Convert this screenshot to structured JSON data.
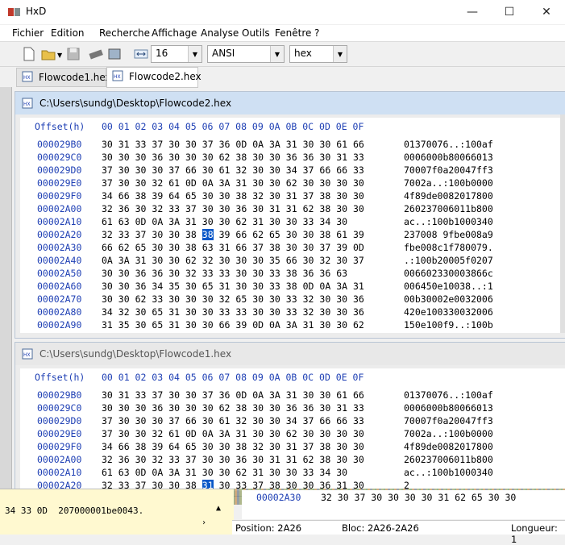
{
  "app": {
    "title": "HxD"
  },
  "window_controls": {
    "minimize": "—",
    "maximize": "☐",
    "close": "✕"
  },
  "menu": [
    "Fichier",
    "Edition",
    "Recherche",
    "Affichage",
    "Analyse",
    "Outils",
    "Fenêtre",
    "?"
  ],
  "toolbar": {
    "bytes_per_row": "16",
    "charset": "ANSI",
    "display_mode": "hex"
  },
  "tabs": [
    {
      "label": "Flowcode1.hex"
    },
    {
      "label": "Flowcode2.hex"
    }
  ],
  "windows": [
    {
      "caption": "C:\\Users\\sundg\\Desktop\\Flowcode2.hex",
      "header_offset": "Offset(h)",
      "header_cols": "00 01 02 03 04 05 06 07 08 09 0A 0B 0C 0D 0E 0F",
      "rows": [
        {
          "off": "000029B0",
          "hex": "30 31 33 37 30 30 37 36 0D 0A 3A 31 30 30 61 66",
          "text": "01370076..:100af"
        },
        {
          "off": "000029C0",
          "hex": "30 30 30 36 30 30 30 62 38 30 30 36 36 30 31 33",
          "text": "0006000b80066013"
        },
        {
          "off": "000029D0",
          "hex": "37 30 30 30 37 66 30 61 32 30 30 34 37 66 66 33",
          "text": "70007f0a20047ff3"
        },
        {
          "off": "000029E0",
          "hex": "37 30 30 32 61 0D 0A 3A 31 30 30 62 30 30 30 30",
          "text": "7002a..:100b0000"
        },
        {
          "off": "000029F0",
          "hex": "34 66 38 39 64 65 30 30 38 32 30 31 37 38 30 30",
          "text": "4f89de0082017800"
        },
        {
          "off": "00002A00",
          "hex": "32 36 30 32 33 37 30 30 36 30 31 31 62 38 30 30",
          "text": "260237006011b800"
        },
        {
          "off": "00002A10",
          "hex": "61 63 0D 0A 3A 31 30 30 62 31 30 30 33 34 30",
          "text": "ac..:100b1000340"
        },
        {
          "off": "00002A20",
          "hex": "32 33 37 30 30 38 38 39 66 62 65 30 30 38 61 39",
          "text": "237008 9fbe008a9"
        },
        {
          "off": "00002A30",
          "hex": "66 62 65 30 30 38 63 31 66 37 38 30 30 37 39 0D",
          "text": "fbe008c1f780079."
        },
        {
          "off": "00002A40",
          "hex": "0A 3A 31 30 30 62 32 30 30 30 35 66 30 32 30 37",
          "text": ".:100b20005f0207"
        },
        {
          "off": "00002A50",
          "hex": "30 30 36 36 30 32 33 33 30 30 33 38 36 36 63",
          "text": "006602330003866c"
        },
        {
          "off": "00002A60",
          "hex": "30 30 36 34 35 30 65 31 30 30 33 38 0D 0A 3A 31",
          "text": "006450e10038..:1"
        },
        {
          "off": "00002A70",
          "hex": "30 30 62 33 30 30 30 32 65 30 30 33 32 30 30 36",
          "text": "00b30002e0032006"
        },
        {
          "off": "00002A80",
          "hex": "34 32 30 65 31 30 30 33 33 30 30 33 32 30 30 36",
          "text": "420e100330032006"
        },
        {
          "off": "00002A90",
          "hex": "31 35 30 65 31 30 30 66 39 0D 0A 3A 31 30 30 62",
          "text": "150e100f9..:100b"
        }
      ],
      "selected_byte": "38"
    },
    {
      "caption": "C:\\Users\\sundg\\Desktop\\Flowcode1.hex",
      "header_offset": "Offset(h)",
      "header_cols": "00 01 02 03 04 05 06 07 08 09 0A 0B 0C 0D 0E 0F",
      "rows": [
        {
          "off": "000029B0",
          "hex": "30 31 33 37 30 30 37 36 0D 0A 3A 31 30 30 61 66",
          "text": "01370076..:100af"
        },
        {
          "off": "000029C0",
          "hex": "30 30 30 36 30 30 30 62 38 30 30 36 36 30 31 33",
          "text": "0006000b80066013"
        },
        {
          "off": "000029D0",
          "hex": "37 30 30 30 37 66 30 61 32 30 30 34 37 66 66 33",
          "text": "70007f0a20047ff3"
        },
        {
          "off": "000029E0",
          "hex": "37 30 30 32 61 0D 0A 3A 31 30 30 62 30 30 30 30",
          "text": "7002a..:100b0000"
        },
        {
          "off": "000029F0",
          "hex": "34 66 38 39 64 65 30 30 38 32 30 31 37 38 30 30",
          "text": "4f89de0082017800"
        },
        {
          "off": "00002A00",
          "hex": "32 36 30 32 33 37 30 30 36 30 31 31 62 38 30 30",
          "text": "260237006011b800"
        },
        {
          "off": "00002A10",
          "hex": "61 63 0D 0A 3A 31 30 30 62 31 30 30 33 34 30",
          "text": "ac..:100b1000340"
        },
        {
          "off": "00002A20",
          "hex": "32 33 37 30 30 38 31 30 33 37 38 30 30 36 31 30",
          "text": "2"
        }
      ],
      "selected_byte": "31"
    }
  ],
  "dataview": {
    "line": "34 33 0D  207000001be0043."
  },
  "extra_row": {
    "off": "00002A30",
    "hex": "32 30 37 30 30 30 30 31 62 65 30 30"
  },
  "status": {
    "position": "Position: 2A26",
    "block": "Bloc: 2A26-2A26",
    "length": "Longueur: 1"
  }
}
